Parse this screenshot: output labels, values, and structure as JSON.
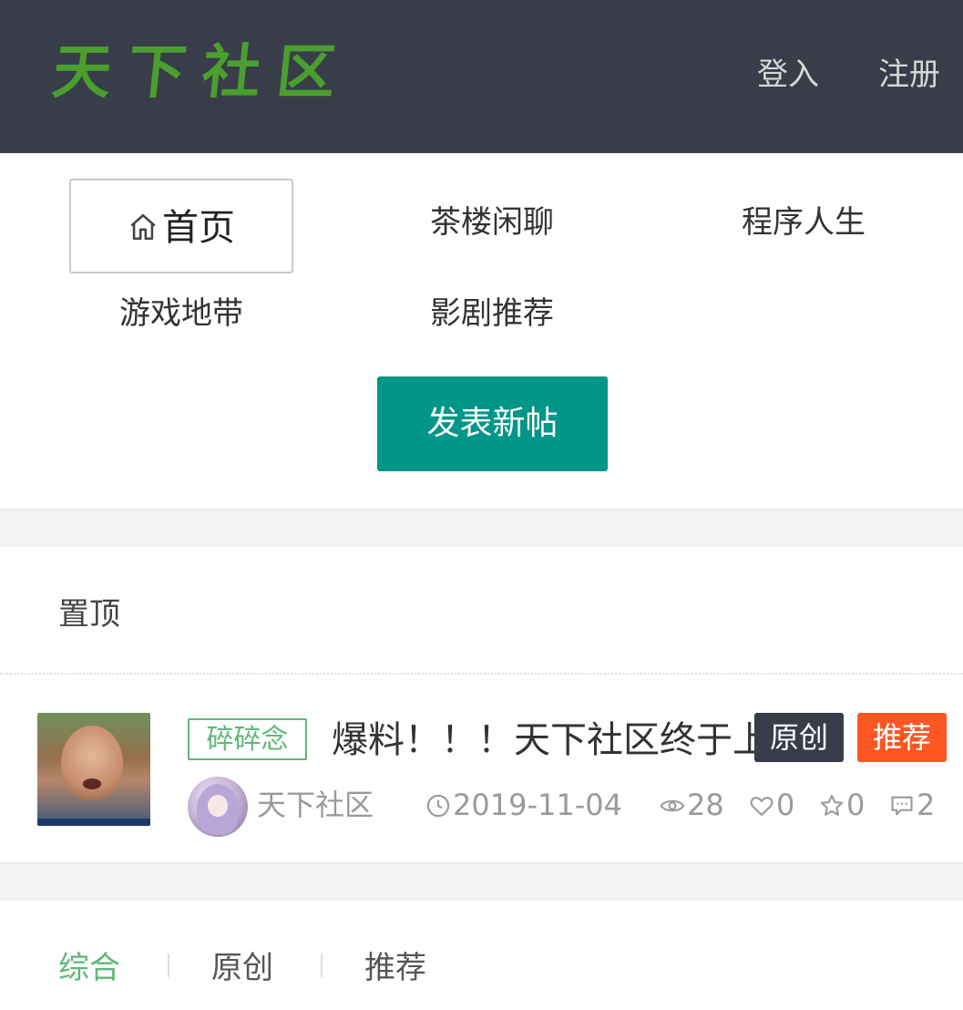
{
  "header": {
    "logo_text": "天下社区",
    "login_label": "登入",
    "register_label": "注册"
  },
  "nav": {
    "items": [
      {
        "label": "首页",
        "active": true
      },
      {
        "label": "茶楼闲聊"
      },
      {
        "label": "程序人生"
      },
      {
        "label": "游戏地带"
      },
      {
        "label": "影剧推荐"
      }
    ],
    "new_post_label": "发表新帖"
  },
  "pinned": {
    "section_title": "置顶",
    "post": {
      "category": "碎碎念",
      "title": "爆料！！！天下社区终于上线了",
      "badge_original": "原创",
      "badge_recommend": "推荐",
      "author": "天下社区",
      "date": "2019-11-04",
      "views": "28",
      "likes": "0",
      "favorites": "0",
      "comments": "2"
    }
  },
  "tabs": {
    "items": [
      "综合",
      "原创",
      "推荐"
    ]
  },
  "colors": {
    "header_bg": "#393d49",
    "logo": "#4a9f2f",
    "primary_button": "#009688",
    "accent_green": "#5fb878",
    "badge_dark": "#393d49",
    "badge_orange": "#ff5722"
  }
}
